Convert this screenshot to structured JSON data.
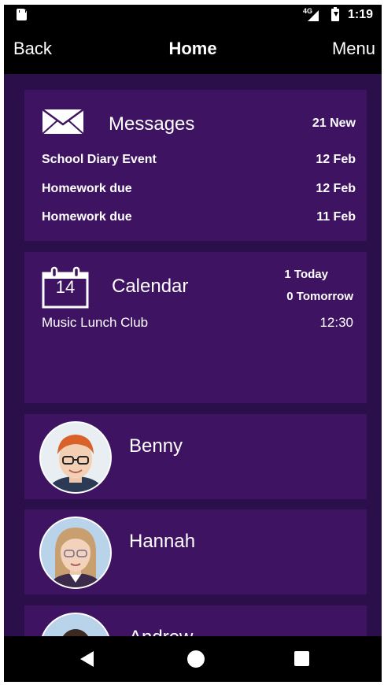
{
  "status_bar": {
    "network": "4G",
    "time": "1:19",
    "icons": [
      "sd-card-icon",
      "signal-icon",
      "battery-icon"
    ]
  },
  "nav": {
    "back_label": "Back",
    "title": "Home",
    "menu_label": "Menu"
  },
  "messages": {
    "icon": "envelope-icon",
    "title": "Messages",
    "new_count": "21 New",
    "items": [
      {
        "subject": "School Diary Event",
        "date": "12 Feb"
      },
      {
        "subject": "Homework due",
        "date": "12 Feb"
      },
      {
        "subject": "Homework due",
        "date": "11 Feb"
      }
    ]
  },
  "calendar": {
    "icon": "calendar-icon",
    "icon_day": "14",
    "title": "Calendar",
    "today": "1 Today",
    "tomorrow": "0 Tomorrow",
    "events": [
      {
        "name": "Music Lunch Club",
        "time": "12:30"
      }
    ]
  },
  "children": [
    {
      "name": "Benny"
    },
    {
      "name": "Hannah"
    },
    {
      "name": "Andrew"
    }
  ],
  "system_nav": {
    "icons": [
      "back-triangle-icon",
      "home-circle-icon",
      "recents-square-icon"
    ]
  },
  "colors": {
    "background": "#2a0f4a",
    "card": "#3e1462",
    "bars": "#000000",
    "text": "#ffffff"
  }
}
